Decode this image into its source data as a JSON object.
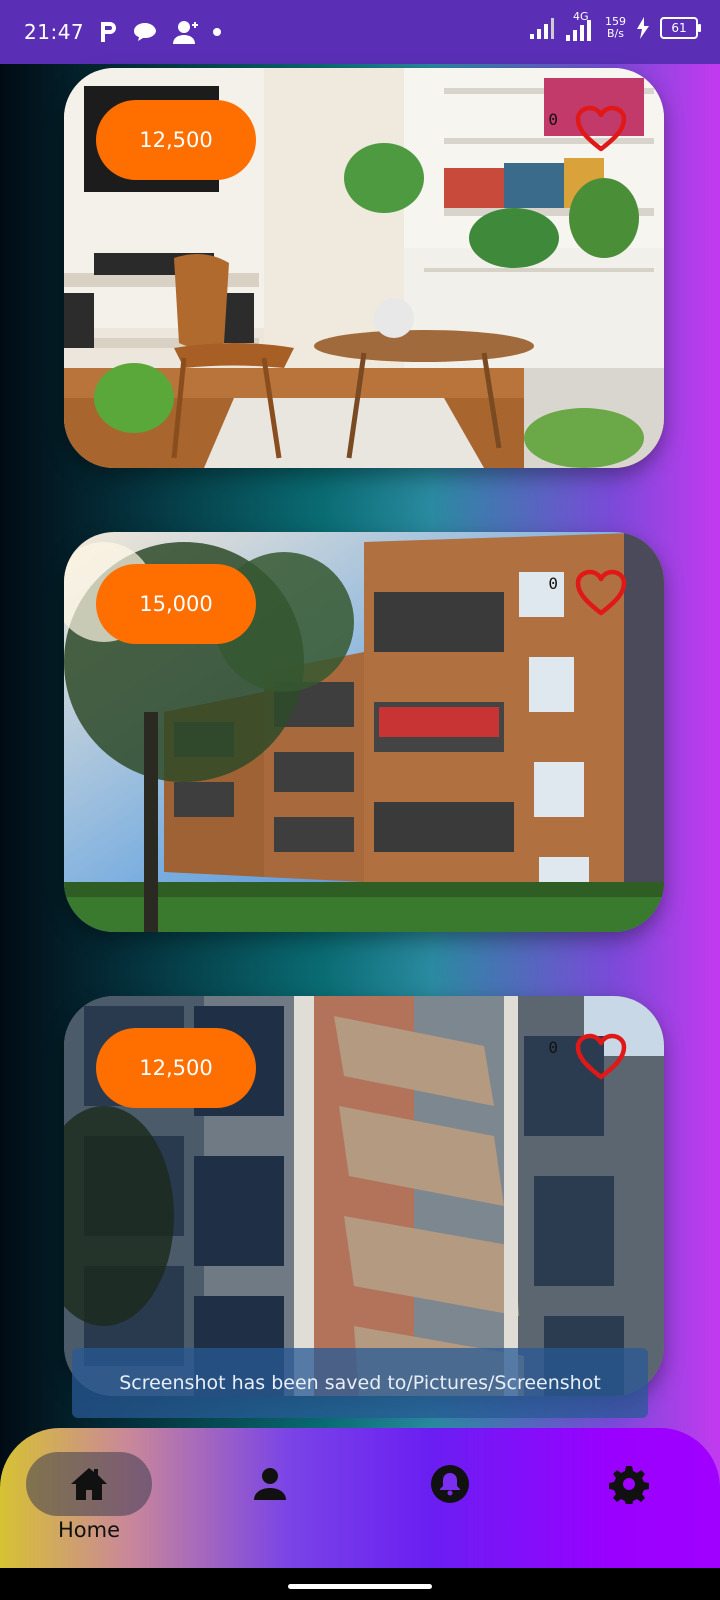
{
  "status_bar": {
    "time": "21:47",
    "net_speed_value": "159",
    "net_speed_unit": "B/s",
    "network_type": "4G",
    "battery_level": "61"
  },
  "listings": [
    {
      "price": "12,500",
      "favorites_count": "0"
    },
    {
      "price": "15,000",
      "favorites_count": "0"
    },
    {
      "price": "12,500",
      "favorites_count": "0"
    }
  ],
  "toast": {
    "message": "Screenshot has been saved to/Pictures/Screenshot"
  },
  "bottom_nav": {
    "items": [
      {
        "icon": "home-icon",
        "label": "Home",
        "active": true
      },
      {
        "icon": "person-icon",
        "label": ""
      },
      {
        "icon": "bell-icon",
        "label": ""
      },
      {
        "icon": "settings-icon",
        "label": ""
      }
    ]
  },
  "colors": {
    "price_badge": "#ff6f00",
    "heart": "#e01818",
    "status_bar": "#5a2fb6"
  }
}
